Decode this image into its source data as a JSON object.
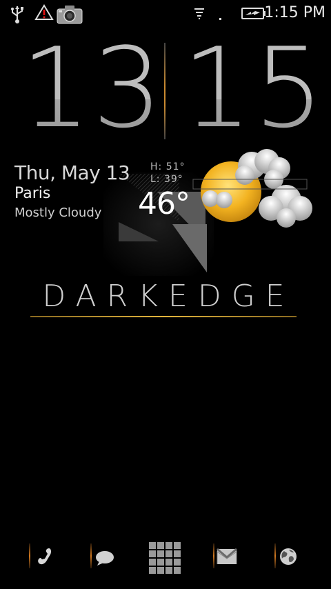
{
  "status_bar": {
    "time": "1:15 PM",
    "icons": [
      "usb-icon",
      "warning-icon",
      "camera-icon",
      "signal-icon",
      "battery-charging-icon"
    ]
  },
  "clock": {
    "hours": "13",
    "minutes": "15"
  },
  "weather": {
    "date": "Thu, May 13",
    "city": "Paris",
    "condition": "Mostly Cloudy",
    "high": "H:  51°",
    "low": "L:  39°",
    "temp": "46°",
    "icon": "partly-cloudy-icon"
  },
  "brand": {
    "name": "DARKEDGE",
    "accent_color": "#e2b43c"
  },
  "dock": {
    "items": [
      "phone-icon",
      "messaging-icon",
      "app-drawer-icon",
      "gmail-icon",
      "browser-icon"
    ]
  }
}
